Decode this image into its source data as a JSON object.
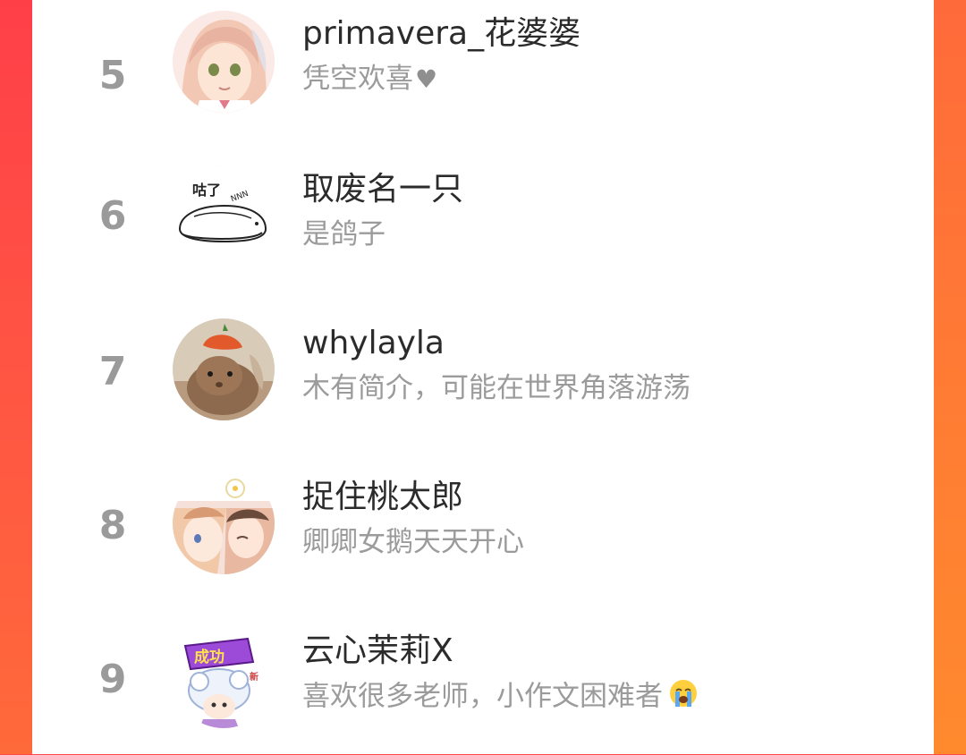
{
  "colors": {
    "accent_left": "#ff3f48",
    "accent_right": "#ff8a2e",
    "card_bg": "#ffffff",
    "rank_text": "#9a9a9a",
    "name_text": "#2b2b2b",
    "bio_text": "#9b9b9b"
  },
  "ranking": {
    "entries": [
      {
        "rank": "5",
        "name": "primavera_花婆婆",
        "bio": "凭空欢喜",
        "bio_icon": "heart-icon",
        "avatar_icon": "anime-girl-avatar"
      },
      {
        "rank": "6",
        "name": "取废名一只",
        "bio": "是鸽子",
        "avatar_icon": "sleeping-sketch-avatar"
      },
      {
        "rank": "7",
        "name": "whylayla",
        "bio": "木有简介，可能在世界角落游荡",
        "avatar_icon": "rabbit-photo-avatar"
      },
      {
        "rank": "8",
        "name": "捉住桃太郎",
        "bio": "卿卿女鹅天天开心",
        "avatar_icon": "anime-couple-avatar"
      },
      {
        "rank": "9",
        "name": "云心茉莉X",
        "bio": "喜欢很多老师，小作文困难者",
        "bio_icon": "crying-face-icon",
        "avatar_icon": "cartoon-success-avatar",
        "avatar_badge": "成功"
      }
    ]
  }
}
